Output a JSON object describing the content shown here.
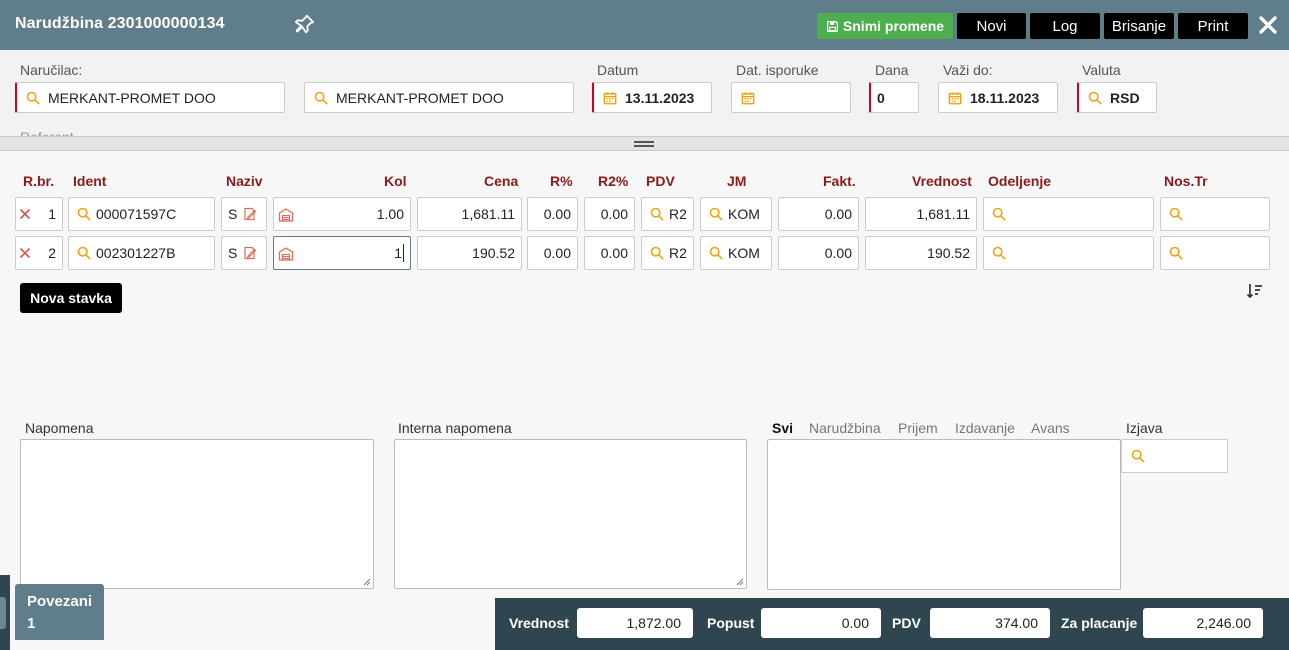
{
  "titlebar": {
    "title": "Narudžbina 2301000000134",
    "save_label": "Snimi promene",
    "buttons": [
      "Novi",
      "Log",
      "Brisanje",
      "Print"
    ]
  },
  "header": {
    "narucilac_label": "Naručilac:",
    "narucilac_value": "MERKANT-PROMET DOO",
    "narucilac2_value": "MERKANT-PROMET DOO",
    "datum_label": "Datum",
    "datum_value": "13.11.2023",
    "isporuka_label": "Dat. isporuke",
    "isporuka_value": "",
    "dana_label": "Dana",
    "dana_value": "0",
    "vazi_label": "Važi do:",
    "vazi_value": "18.11.2023",
    "valuta_label": "Valuta",
    "valuta_value": "RSD",
    "cutoff_label": "Referent"
  },
  "table": {
    "columns": [
      "R.br.",
      "Ident",
      "Naziv",
      "Kol",
      "Cena",
      "R%",
      "R2%",
      "PDV",
      "JM",
      "Fakt.",
      "Vrednost",
      "Odeljenje",
      "Nos.Tr"
    ],
    "rows": [
      {
        "rbr": "1",
        "ident": "000071597C",
        "naziv": "S",
        "kol": "1.00",
        "cena": "1,681.11",
        "r": "0.00",
        "r2": "0.00",
        "pdv": "R2",
        "jm": "KOM",
        "fakt": "0.00",
        "vrednost": "1,681.11",
        "odeljenje": "",
        "nostr": ""
      },
      {
        "rbr": "2",
        "ident": "002301227B",
        "naziv": "S",
        "kol": "1",
        "cena": "190.52",
        "r": "0.00",
        "r2": "0.00",
        "pdv": "R2",
        "jm": "KOM",
        "fakt": "0.00",
        "vrednost": "190.52",
        "odeljenje": "",
        "nostr": ""
      }
    ],
    "add_label": "Nova stavka"
  },
  "notes": {
    "napomena_label": "Napomena",
    "interna_label": "Interna napomena",
    "tabs": [
      "Svi",
      "Narudžbina",
      "Prijem",
      "Izdavanje",
      "Avans"
    ],
    "izjava_label": "Izjava"
  },
  "footer": {
    "povezani_label": "Povezani",
    "povezani_count": "1",
    "vrednost_label": "Vrednost",
    "vrednost_value": "1,872.00",
    "popust_label": "Popust",
    "popust_value": "0.00",
    "pdv_label": "PDV",
    "pdv_value": "374.00",
    "zaplacanje_label": "Za placanje",
    "zaplacanje_value": "2,246.00"
  },
  "colors": {
    "titlebar": "#5f7d8a",
    "save_green": "#4cae4c",
    "header_red": "#8b1a1a",
    "required": "#d0021b",
    "icon_orange": "#f0a30a"
  }
}
